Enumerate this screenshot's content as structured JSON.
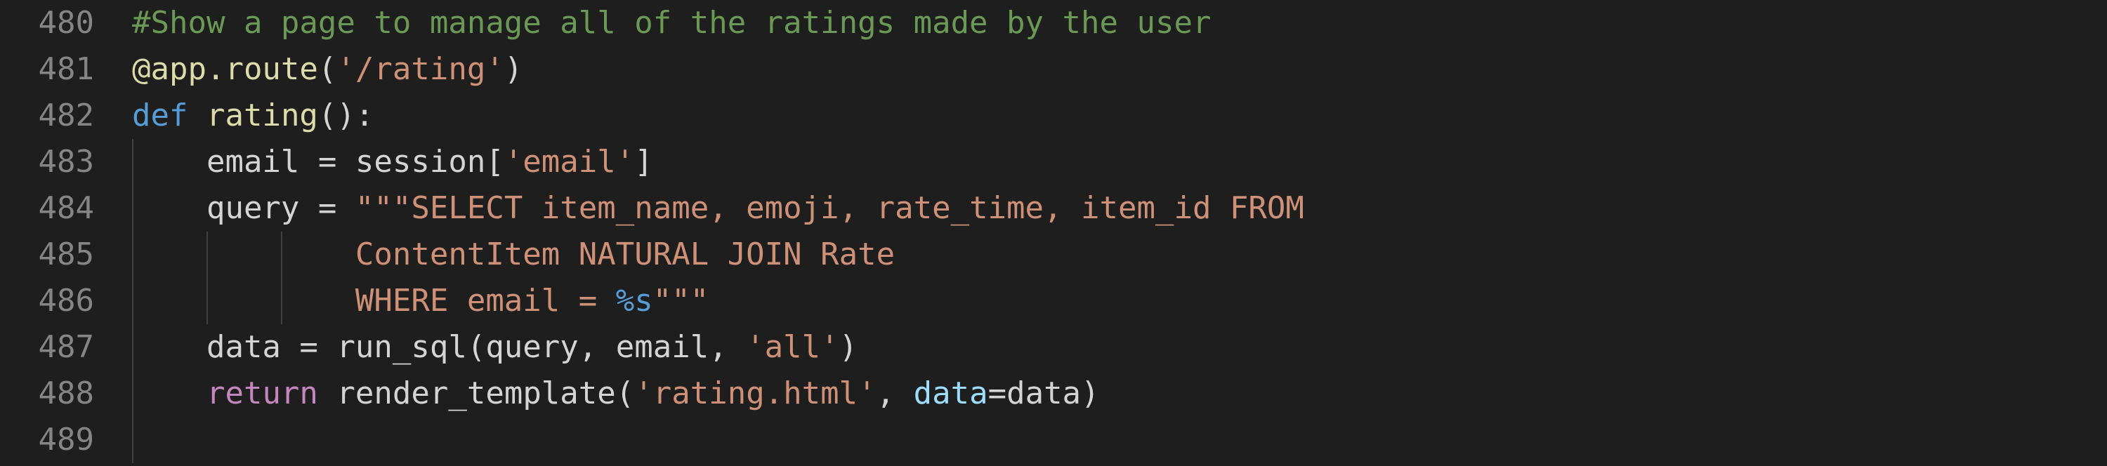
{
  "editor": {
    "theme_colors": {
      "background": "#1e1e1e",
      "line_number": "#858585",
      "comment": "#6a9955",
      "keyword": "#569cd6",
      "control": "#c586c0",
      "function": "#dcdcaa",
      "string": "#ce9178",
      "parameter": "#9cdcfe",
      "default": "#d4d4d4"
    },
    "lines": [
      {
        "number": "480",
        "tokens": [
          {
            "type": "comment",
            "text": "#Show a page to manage all of the ratings made by the user"
          }
        ]
      },
      {
        "number": "481",
        "tokens": [
          {
            "type": "decorator",
            "text": "@app.route"
          },
          {
            "type": "plain",
            "text": "("
          },
          {
            "type": "string",
            "text": "'/rating'"
          },
          {
            "type": "plain",
            "text": ")"
          }
        ]
      },
      {
        "number": "482",
        "tokens": [
          {
            "type": "keyword",
            "text": "def"
          },
          {
            "type": "plain",
            "text": " "
          },
          {
            "type": "func",
            "text": "rating"
          },
          {
            "type": "plain",
            "text": "():"
          }
        ]
      },
      {
        "number": "483",
        "tokens": [
          {
            "type": "plain",
            "text": "    email = session["
          },
          {
            "type": "string",
            "text": "'email'"
          },
          {
            "type": "plain",
            "text": "]"
          }
        ]
      },
      {
        "number": "484",
        "tokens": [
          {
            "type": "plain",
            "text": "    query = "
          },
          {
            "type": "string",
            "text": "\"\"\"SELECT item_name, emoji, rate_time, item_id FROM"
          }
        ]
      },
      {
        "number": "485",
        "tokens": [
          {
            "type": "string",
            "text": "            ContentItem NATURAL JOIN Rate"
          }
        ]
      },
      {
        "number": "486",
        "tokens": [
          {
            "type": "string",
            "text": "            WHERE email = "
          },
          {
            "type": "format",
            "text": "%s"
          },
          {
            "type": "string",
            "text": "\"\"\""
          }
        ]
      },
      {
        "number": "487",
        "tokens": [
          {
            "type": "plain",
            "text": "    data = run_sql(query, email, "
          },
          {
            "type": "string",
            "text": "'all'"
          },
          {
            "type": "plain",
            "text": ")"
          }
        ]
      },
      {
        "number": "488",
        "tokens": [
          {
            "type": "plain",
            "text": "    "
          },
          {
            "type": "control",
            "text": "return"
          },
          {
            "type": "plain",
            "text": " render_template("
          },
          {
            "type": "string",
            "text": "'rating.html'"
          },
          {
            "type": "plain",
            "text": ", "
          },
          {
            "type": "param",
            "text": "data"
          },
          {
            "type": "plain",
            "text": "=data)"
          }
        ]
      },
      {
        "number": "489",
        "tokens": []
      }
    ]
  }
}
